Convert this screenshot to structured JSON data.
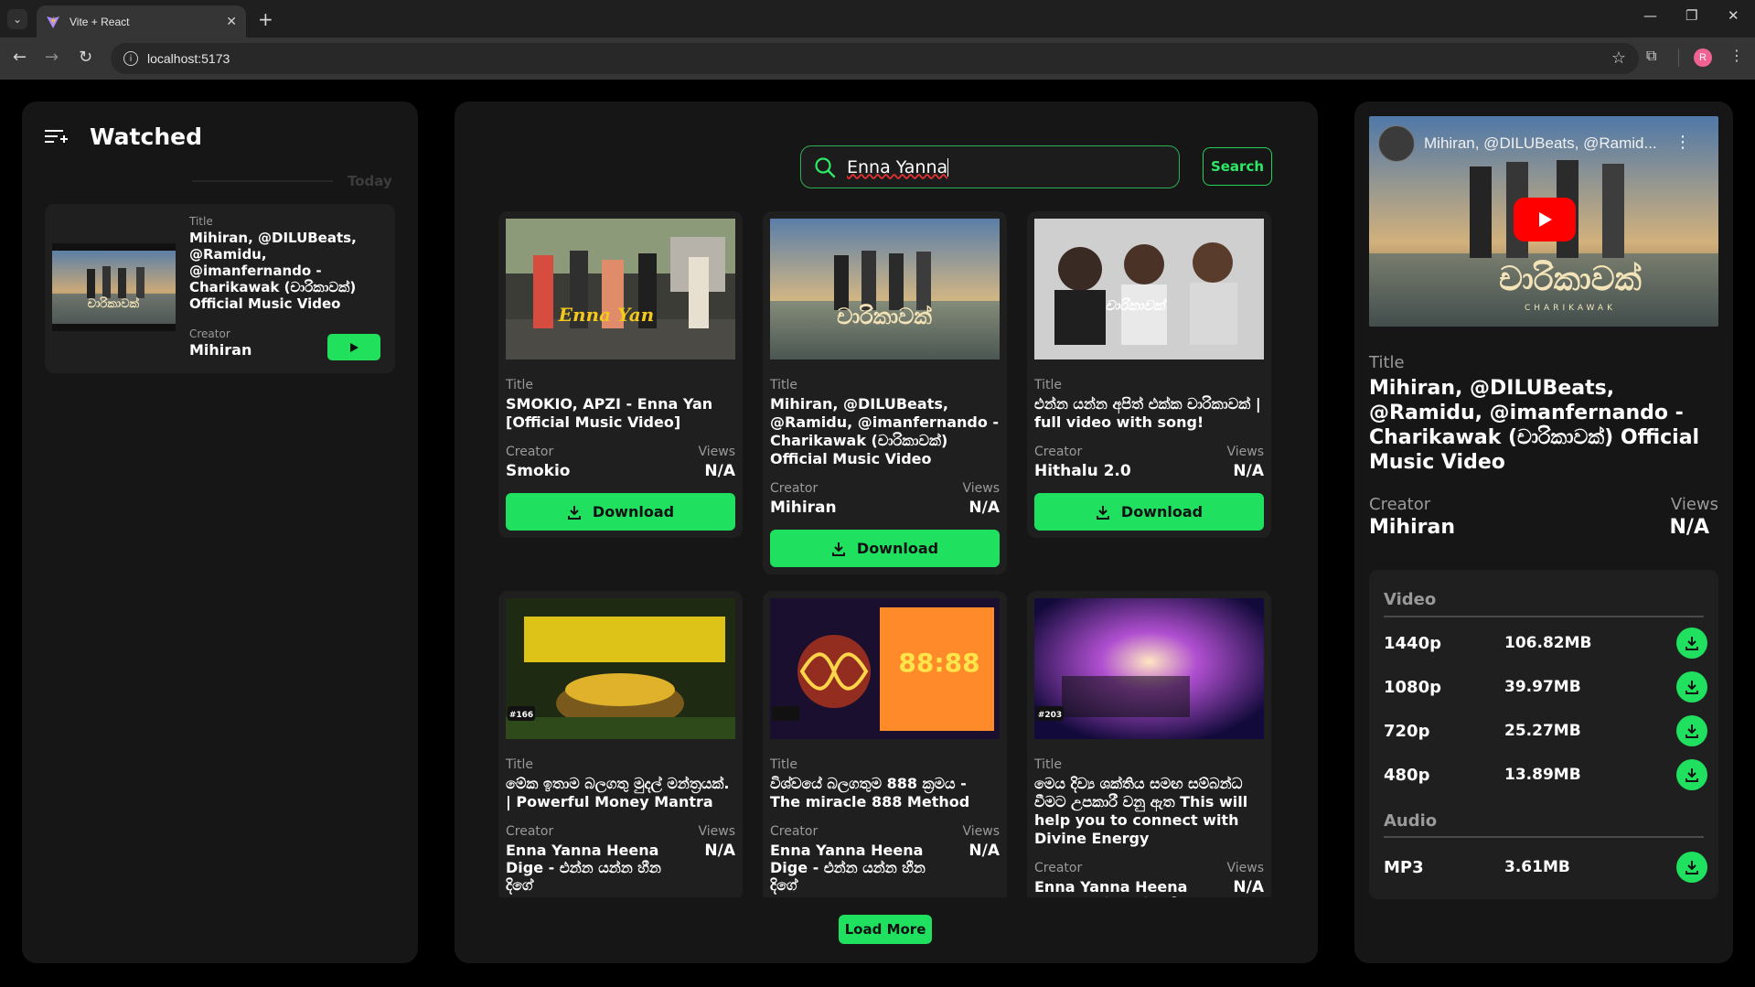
{
  "browser": {
    "tab_title": "Vite + React",
    "url": "localhost:5173",
    "profile_initial": "R"
  },
  "sidebar": {
    "title": "Watched",
    "day_label": "Today",
    "items": [
      {
        "title_label": "Title",
        "title": "Mihiran, @DILUBeats, @Ramidu, @imanfernando - Charikawak (චාරිකාවක්) Official Music Video",
        "creator_label": "Creator",
        "creator": "Mihiran"
      }
    ]
  },
  "search": {
    "value": "Enna Yanna",
    "button_label": "Search"
  },
  "results": [
    {
      "title": "SMOKIO, APZI - Enna Yan [Official Music Video]",
      "creator": "Smokio",
      "views": "N/A",
      "thumb_text": "Enna Yan"
    },
    {
      "title": "Mihiran, @DILUBeats, @Ramidu, @imanfernando - Charikawak (චාරිකාවක්) Official Music Video",
      "creator": "Mihiran",
      "views": "N/A",
      "thumb_text": "චාරිකාවක්"
    },
    {
      "title": "එන්න යන්න අපිත් එක්ක චාරිකාවක් | full video with song!",
      "creator": "Hithalu 2.0",
      "views": "N/A",
      "thumb_text": "චාරිකාවක්"
    },
    {
      "title": "මේක ඉතාම බලගතු මුදල් මන්ත්‍රයක්. | Powerful Money Mantra",
      "creator": "Enna Yanna Heena Dige - එන්න යන්න හීන දිගේ",
      "views": "N/A",
      "thumb_text": "#166"
    },
    {
      "title": "විශ්වයේ බලගතුම 888 ක්‍රමය - The miracle 888 Method",
      "creator": "Enna Yanna Heena Dige - එන්න යන්න හීන දිගේ",
      "views": "N/A",
      "thumb_text": "88:88"
    },
    {
      "title": "මෙය දිව්‍ය ශක්තිය සමඟ සම්බන්ධ වීමට උපකාරී වනු ඇත This will help you to connect with Divine Energy",
      "creator": "Enna Yanna Heena Dige - එන්න යන්න හීන දිගේ",
      "views": "N/A",
      "thumb_text": "#203"
    }
  ],
  "labels": {
    "title": "Title",
    "creator": "Creator",
    "views": "Views",
    "download": "Download",
    "load_more": "Load More"
  },
  "player": {
    "overlay_title": "Mihiran, @DILUBeats, @Ramid...",
    "thumb_text": "චාරිකාවක්",
    "thumb_subtext": "CHARIKAWAK",
    "title_label": "Title",
    "title": "Mihiran, @DILUBeats, @Ramidu, @imanfernando - Charikawak (චාරිකාවක්) Official Music Video",
    "creator_label": "Creator",
    "creator": "Mihiran",
    "views_label": "Views",
    "views": "N/A"
  },
  "downloads": {
    "video_label": "Video",
    "audio_label": "Audio",
    "video": [
      {
        "quality": "1440p",
        "size": "106.82MB"
      },
      {
        "quality": "1080p",
        "size": "39.97MB"
      },
      {
        "quality": "720p",
        "size": "25.27MB"
      },
      {
        "quality": "480p",
        "size": "13.89MB"
      }
    ],
    "audio": [
      {
        "quality": "MP3",
        "size": "3.61MB"
      }
    ]
  },
  "colors": {
    "accent": "#1fe15f",
    "panel": "#161616",
    "card": "#1f1f1f"
  }
}
